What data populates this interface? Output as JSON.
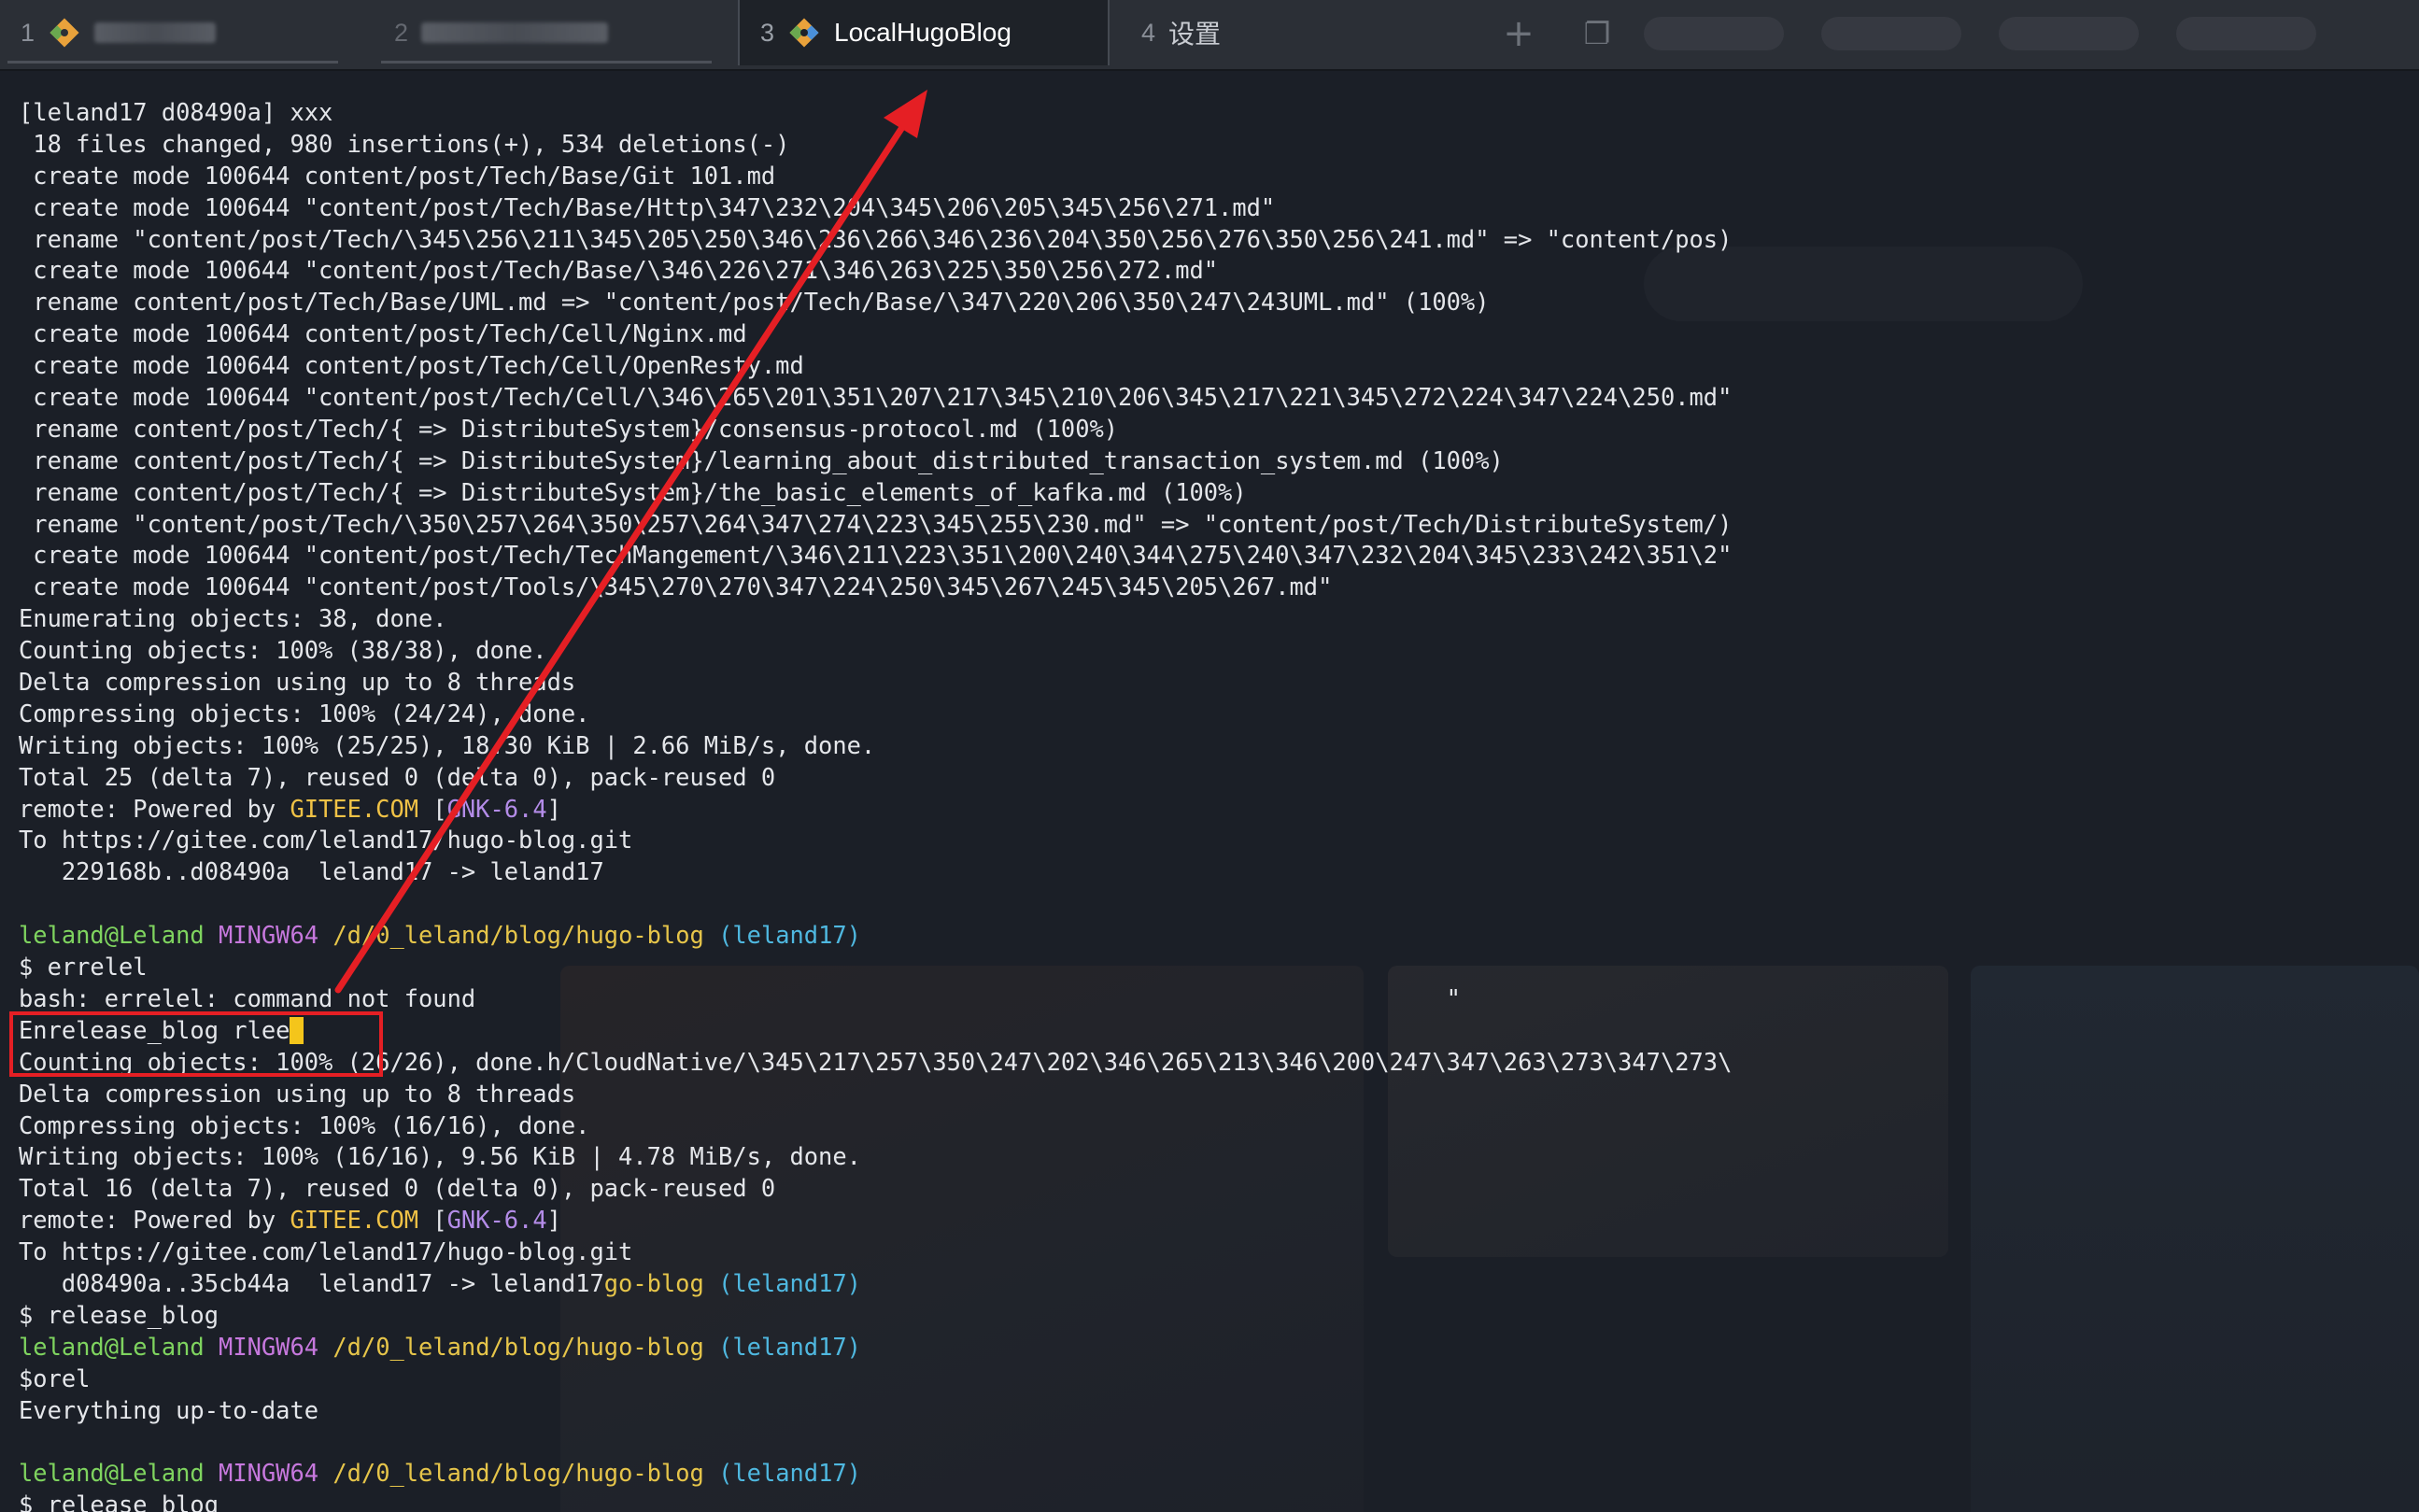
{
  "tabs": [
    {
      "number": "1",
      "label": "",
      "blurred": true,
      "icon": "git-icon"
    },
    {
      "number": "2",
      "label": "",
      "blurred": true,
      "icon": "terminal-icon"
    },
    {
      "number": "3",
      "label": "LocalHugoBlog",
      "blurred": false,
      "icon": "git-icon",
      "active": true
    },
    {
      "number": "4",
      "label": "设置",
      "blurred": false,
      "icon": "none"
    }
  ],
  "tab_actions": {
    "new_tab_glyph": "+",
    "window_glyph": "❐"
  },
  "terminal": {
    "lines": [
      [
        {
          "t": "[leland17 d08490a] xxx"
        }
      ],
      [
        {
          "t": " 18 files changed, 980 insertions(+), 534 deletions(-)"
        }
      ],
      [
        {
          "t": " create mode 100644 content/post/Tech/Base/Git 101.md"
        }
      ],
      [
        {
          "t": " create mode 100644 \"content/post/Tech/Base/Http\\347\\232\\204\\345\\206\\205\\345\\256\\271.md\""
        }
      ],
      [
        {
          "t": " rename \"content/post/Tech/\\345\\256\\211\\345\\205\\250\\346\\236\\266\\346\\236\\204\\350\\256\\276\\350\\256\\241.md\" => \"content/pos)"
        }
      ],
      [
        {
          "t": " create mode 100644 \"content/post/Tech/Base/\\346\\226\\271\\346\\263\\225\\350\\256\\272.md\""
        }
      ],
      [
        {
          "t": " rename content/post/Tech/Base/UML.md => \"content/post/Tech/Base/\\347\\220\\206\\350\\247\\243UML.md\" (100%)"
        }
      ],
      [
        {
          "t": " create mode 100644 content/post/Tech/Cell/Nginx.md"
        }
      ],
      [
        {
          "t": " create mode 100644 content/post/Tech/Cell/OpenResty.md"
        }
      ],
      [
        {
          "t": " create mode 100644 \"content/post/Tech/Cell/\\346\\265\\201\\351\\207\\217\\345\\210\\206\\345\\217\\221\\345\\272\\224\\347\\224\\250.md\""
        }
      ],
      [
        {
          "t": " rename content/post/Tech/{ => DistributeSystem}/consensus-protocol.md (100%)"
        }
      ],
      [
        {
          "t": " rename content/post/Tech/{ => DistributeSystem}/learning_about_distributed_transaction_system.md (100%)"
        }
      ],
      [
        {
          "t": " rename content/post/Tech/{ => DistributeSystem}/the_basic_elements_of_kafka.md (100%)"
        }
      ],
      [
        {
          "t": " rename \"content/post/Tech/\\350\\257\\264\\350\\257\\264\\347\\274\\223\\345\\255\\230.md\" => \"content/post/Tech/DistributeSystem/)"
        }
      ],
      [
        {
          "t": " create mode 100644 \"content/post/Tech/TechMangement/\\346\\211\\223\\351\\200\\240\\344\\275\\240\\347\\232\\204\\345\\233\\242\\351\\2\""
        }
      ],
      [
        {
          "t": " create mode 100644 \"content/post/Tools/\\345\\270\\270\\347\\224\\250\\345\\267\\245\\345\\205\\267.md\""
        }
      ],
      [
        {
          "t": "Enumerating objects: 38, done."
        }
      ],
      [
        {
          "t": "Counting objects: 100% (38/38), done."
        }
      ],
      [
        {
          "t": "Delta compression using up to 8 threads"
        }
      ],
      [
        {
          "t": "Compressing objects: 100% (24/24), done."
        }
      ],
      [
        {
          "t": "Writing objects: 100% (25/25), 18.30 KiB | 2.66 MiB/s, done."
        }
      ],
      [
        {
          "t": "Total 25 (delta 7), reused 0 (delta 0), pack-reused 0"
        }
      ],
      [
        {
          "t": "remote: Powered by "
        },
        {
          "t": "GITEE.COM",
          "c": "gitee"
        },
        {
          "t": " ["
        },
        {
          "t": "GNK-6.4",
          "c": "gnk"
        },
        {
          "t": "]"
        }
      ],
      [
        {
          "t": "To https://gitee.com/leland17/hugo-blog.git"
        }
      ],
      [
        {
          "t": "   229168b..d08490a  leland17 -> leland17"
        }
      ],
      [
        {
          "t": ""
        }
      ],
      [
        {
          "t": "leland@Leland",
          "c": "user"
        },
        {
          "t": " "
        },
        {
          "t": "MINGW64",
          "c": "mingw"
        },
        {
          "t": " "
        },
        {
          "t": "/d/0_leland/blog/hugo-blog",
          "c": "path"
        },
        {
          "t": " "
        },
        {
          "t": "(leland17)",
          "c": "branch"
        }
      ],
      [
        {
          "t": "$ errelel"
        }
      ],
      [
        {
          "t": "bash: errelel: command not found                                                                    \""
        }
      ],
      [
        {
          "t": "Enrelease_blog rlee"
        },
        {
          "cursor": true
        }
      ],
      [
        {
          "t": "Counting objects: 100% (26/26), done.h/CloudNative/\\345\\217\\257\\350\\247\\202\\346\\265\\213\\346\\200\\247\\347\\263\\273\\347\\273\\"
        }
      ],
      [
        {
          "t": "Delta compression using up to 8 threads"
        }
      ],
      [
        {
          "t": "Compressing objects: 100% (16/16), done."
        }
      ],
      [
        {
          "t": "Writing objects: 100% (16/16), 9.56 KiB | 4.78 MiB/s, done."
        }
      ],
      [
        {
          "t": "Total 16 (delta 7), reused 0 (delta 0), pack-reused 0"
        }
      ],
      [
        {
          "t": "remote: Powered by "
        },
        {
          "t": "GITEE.COM",
          "c": "gitee"
        },
        {
          "t": " ["
        },
        {
          "t": "GNK-6.4",
          "c": "gnk"
        },
        {
          "t": "]"
        }
      ],
      [
        {
          "t": "To https://gitee.com/leland17/hugo-blog.git"
        }
      ],
      [
        {
          "t": "   d08490a..35cb44a  leland17 -> leland17"
        },
        {
          "t": "go-blog",
          "c": "path"
        },
        {
          "t": " "
        },
        {
          "t": "(leland17)",
          "c": "branch"
        }
      ],
      [
        {
          "t": "$ release_blog"
        }
      ],
      [
        {
          "t": "leland@Leland",
          "c": "user"
        },
        {
          "t": " "
        },
        {
          "t": "MINGW64",
          "c": "mingw"
        },
        {
          "t": " "
        },
        {
          "t": "/d/0_leland/blog/hugo-blog",
          "c": "path"
        },
        {
          "t": " "
        },
        {
          "t": "(leland17)",
          "c": "branch"
        }
      ],
      [
        {
          "t": "$orel"
        }
      ],
      [
        {
          "t": "Everything up-to-date"
        }
      ],
      [
        {
          "t": ""
        }
      ],
      [
        {
          "t": "leland@Leland",
          "c": "user"
        },
        {
          "t": " "
        },
        {
          "t": "MINGW64",
          "c": "mingw"
        },
        {
          "t": " "
        },
        {
          "t": "/d/0_leland/blog/hugo-blog",
          "c": "path"
        },
        {
          "t": " "
        },
        {
          "t": "(leland17)",
          "c": "branch"
        }
      ],
      [
        {
          "t": "$ release_blog"
        }
      ]
    ]
  },
  "colors": {
    "user": "#7fd45f",
    "mingw": "#c678dd",
    "path": "#e6c54a",
    "branch": "#4fb8e0",
    "gitee": "#f0c246",
    "gnk": "#b48ce8",
    "annotation_red": "#e51f24",
    "cursor": "#f4c51b"
  },
  "annotations": {
    "highlight_box": "red-rectangle",
    "arrow": "red-arrow-to-active-tab"
  }
}
